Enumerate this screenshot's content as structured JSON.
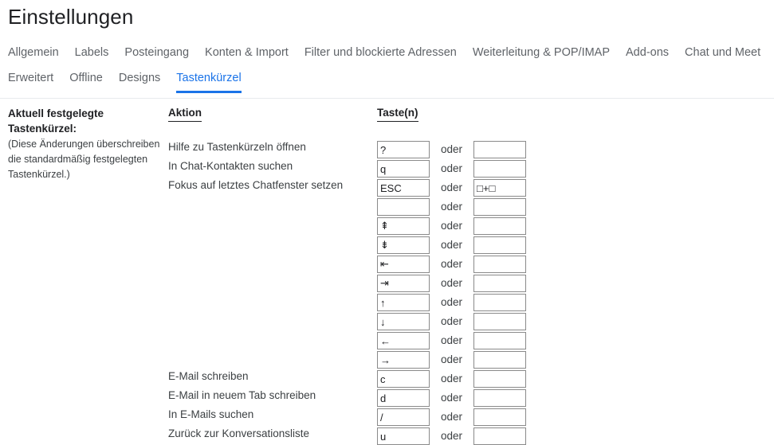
{
  "header": {
    "title": "Einstellungen"
  },
  "tabs": {
    "row1": [
      {
        "label": "Allgemein",
        "active": false
      },
      {
        "label": "Labels",
        "active": false
      },
      {
        "label": "Posteingang",
        "active": false
      },
      {
        "label": "Konten & Import",
        "active": false
      },
      {
        "label": "Filter und blockierte Adressen",
        "active": false
      },
      {
        "label": "Weiterleitung & POP/IMAP",
        "active": false
      },
      {
        "label": "Add-ons",
        "active": false
      },
      {
        "label": "Chat und Meet",
        "active": false
      }
    ],
    "row2": [
      {
        "label": "Erweitert",
        "active": false
      },
      {
        "label": "Offline",
        "active": false
      },
      {
        "label": "Designs",
        "active": false
      },
      {
        "label": "Tastenkürzel",
        "active": true
      }
    ],
    "active_color": "#1a73e8",
    "inactive_color": "#5f6368"
  },
  "info": {
    "heading": "Aktuell festgelegte Tastenkürzel:",
    "note": "(Diese Änderungen überschreiben die standardmäßig festgelegten Tastenkürzel.)"
  },
  "columns": {
    "action_header": "Aktion",
    "keys_header": "Taste(n)",
    "separator_label": "oder"
  },
  "shortcuts": [
    {
      "action": "Hilfe zu Tastenkürzeln öffnen",
      "key1": "?",
      "key2": ""
    },
    {
      "action": "In Chat-Kontakten suchen",
      "key1": "q",
      "key2": ""
    },
    {
      "action": "Fokus auf letztes Chatfenster setzen",
      "key1": "ESC",
      "key2": "□+□"
    },
    {
      "action": "",
      "key1": "",
      "key2": ""
    },
    {
      "action": "",
      "key1": "⇞",
      "key2": ""
    },
    {
      "action": "",
      "key1": "⇟",
      "key2": ""
    },
    {
      "action": "",
      "key1": "⇤",
      "key2": ""
    },
    {
      "action": "",
      "key1": "⇥",
      "key2": ""
    },
    {
      "action": "",
      "key1": "↑",
      "key2": ""
    },
    {
      "action": "",
      "key1": "↓",
      "key2": ""
    },
    {
      "action": "",
      "key1": "←",
      "key2": ""
    },
    {
      "action": "",
      "key1": "→",
      "key2": ""
    },
    {
      "action": "E-Mail schreiben",
      "key1": "c",
      "key2": ""
    },
    {
      "action": "E-Mail in neuem Tab schreiben",
      "key1": "d",
      "key2": ""
    },
    {
      "action": "In E-Mails suchen",
      "key1": "/",
      "key2": ""
    },
    {
      "action": "Zurück zur Konversationsliste",
      "key1": "u",
      "key2": ""
    }
  ]
}
